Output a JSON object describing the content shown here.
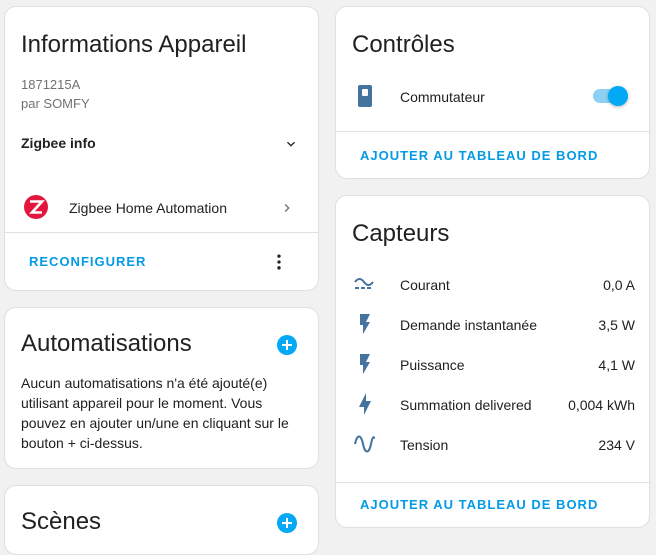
{
  "device_info": {
    "title": "Informations Appareil",
    "model": "1871215A",
    "manufacturer": "par SOMFY",
    "zigbee_info_label": "Zigbee info",
    "integration_label": "Zigbee Home Automation",
    "reconfigure_label": "RECONFIGURER"
  },
  "automations": {
    "title": "Automatisations",
    "empty_text": "Aucun automatisations n'a été ajouté(e) utilisant appareil pour le moment. Vous pouvez en ajouter un/une en cliquant sur le bouton + ci-dessus."
  },
  "scenes": {
    "title": "Scènes"
  },
  "controls": {
    "title": "Contrôles",
    "switch_label": "Commutateur",
    "switch_on": true,
    "add_to_dashboard_label": "AJOUTER AU TABLEAU DE BORD"
  },
  "sensors": {
    "title": "Capteurs",
    "rows": [
      {
        "icon": "current-ac-icon",
        "label": "Courant",
        "value": "0,0 A"
      },
      {
        "icon": "flash-icon",
        "label": "Demande instantanée",
        "value": "3,5 W"
      },
      {
        "icon": "flash-icon",
        "label": "Puissance",
        "value": "4,1 W"
      },
      {
        "icon": "lightning-bolt-icon",
        "label": "Summation delivered",
        "value": "0,004 kWh"
      },
      {
        "icon": "sine-wave-icon",
        "label": "Tension",
        "value": "234 V"
      }
    ],
    "add_to_dashboard_label": "AJOUTER AU TABLEAU DE BORD"
  },
  "colors": {
    "accent": "#03a9f4",
    "link": "#039be5",
    "icon": "#44739e",
    "zigbee_logo": "#e3173e"
  }
}
